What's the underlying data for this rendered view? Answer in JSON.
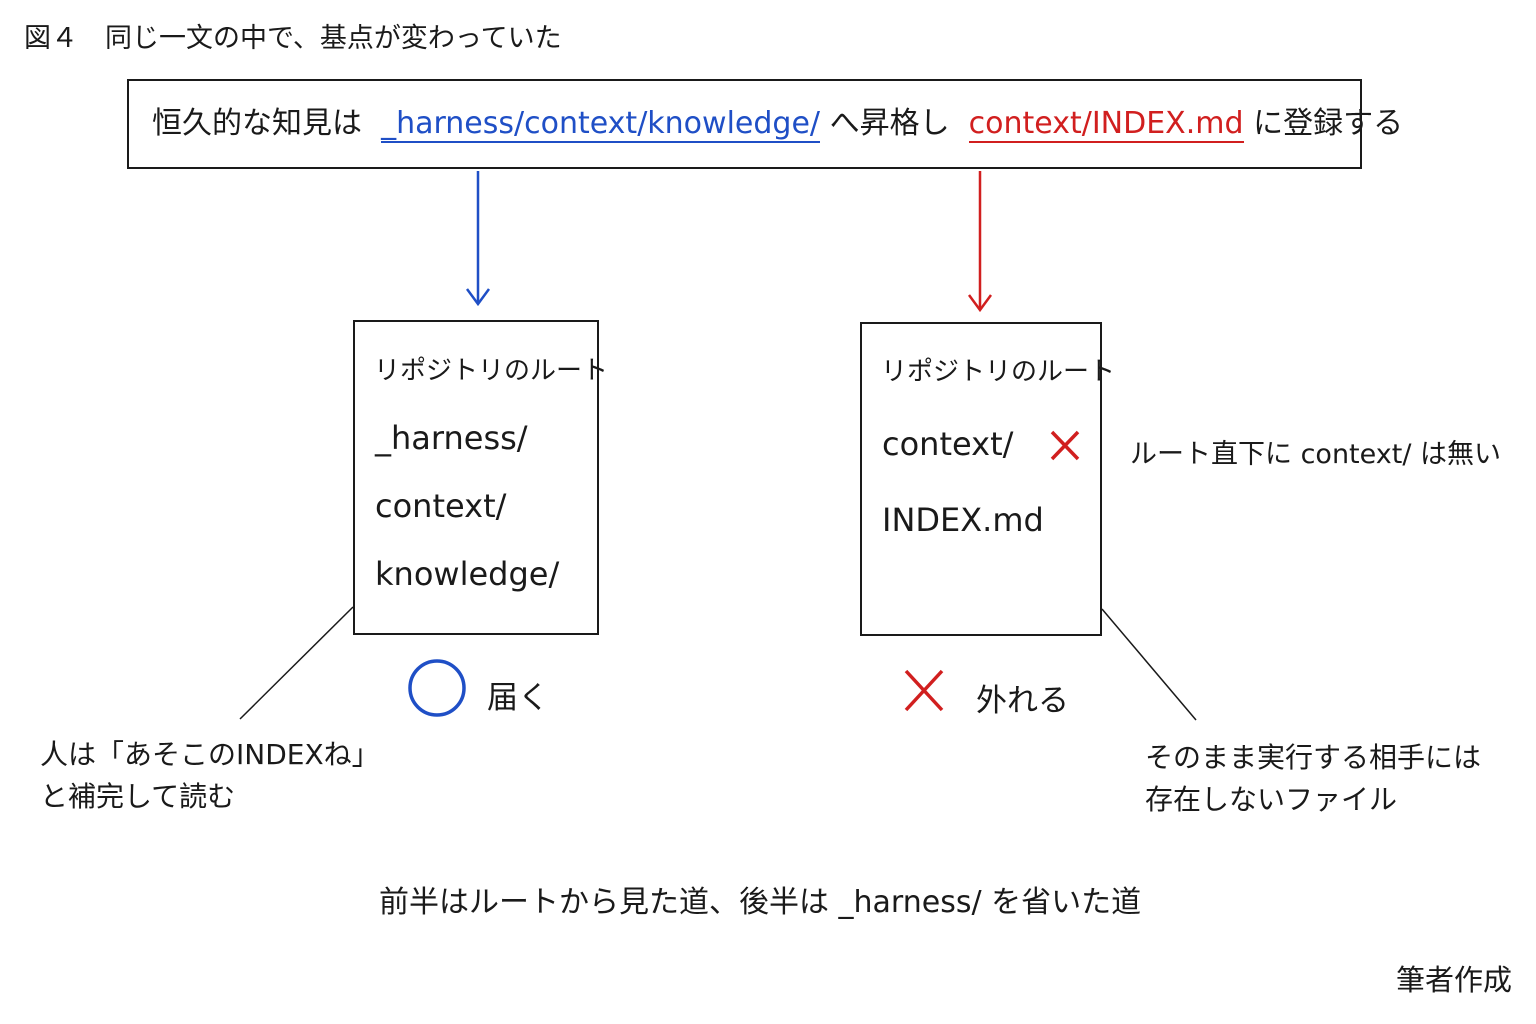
{
  "figure": {
    "title": "図４　同じ一文の中で、基点が変わっていた"
  },
  "sentence": {
    "part1": "恒久的な知見は",
    "blue_path": "_harness/context/knowledge/",
    "part2": "へ昇格し",
    "red_path": "context/INDEX.md",
    "part3": "に登録する"
  },
  "left_panel": {
    "heading": "リポジトリのルート",
    "lines": [
      "_harness/",
      "context/",
      "knowledge/"
    ],
    "result_symbol": "○",
    "result_label": "届く",
    "note_line1": "人は「あそこのINDEXね」",
    "note_line2": "と補完して読む"
  },
  "right_panel": {
    "heading": "リポジトリのルート",
    "lines": [
      "context/",
      "INDEX.md"
    ],
    "missing_mark": "×",
    "side_note": "ルート直下に context/ は無い",
    "result_symbol": "×",
    "result_label": "外れる",
    "note_line1": "そのまま実行する相手には",
    "note_line2": "存在しないファイル"
  },
  "caption": "前半はルートから見た道、後半は _harness/ を省いた道",
  "credit": "筆者作成",
  "colors": {
    "ok": "#1f4fc6",
    "ng": "#d11f1f",
    "ink": "#1a1a1a"
  }
}
